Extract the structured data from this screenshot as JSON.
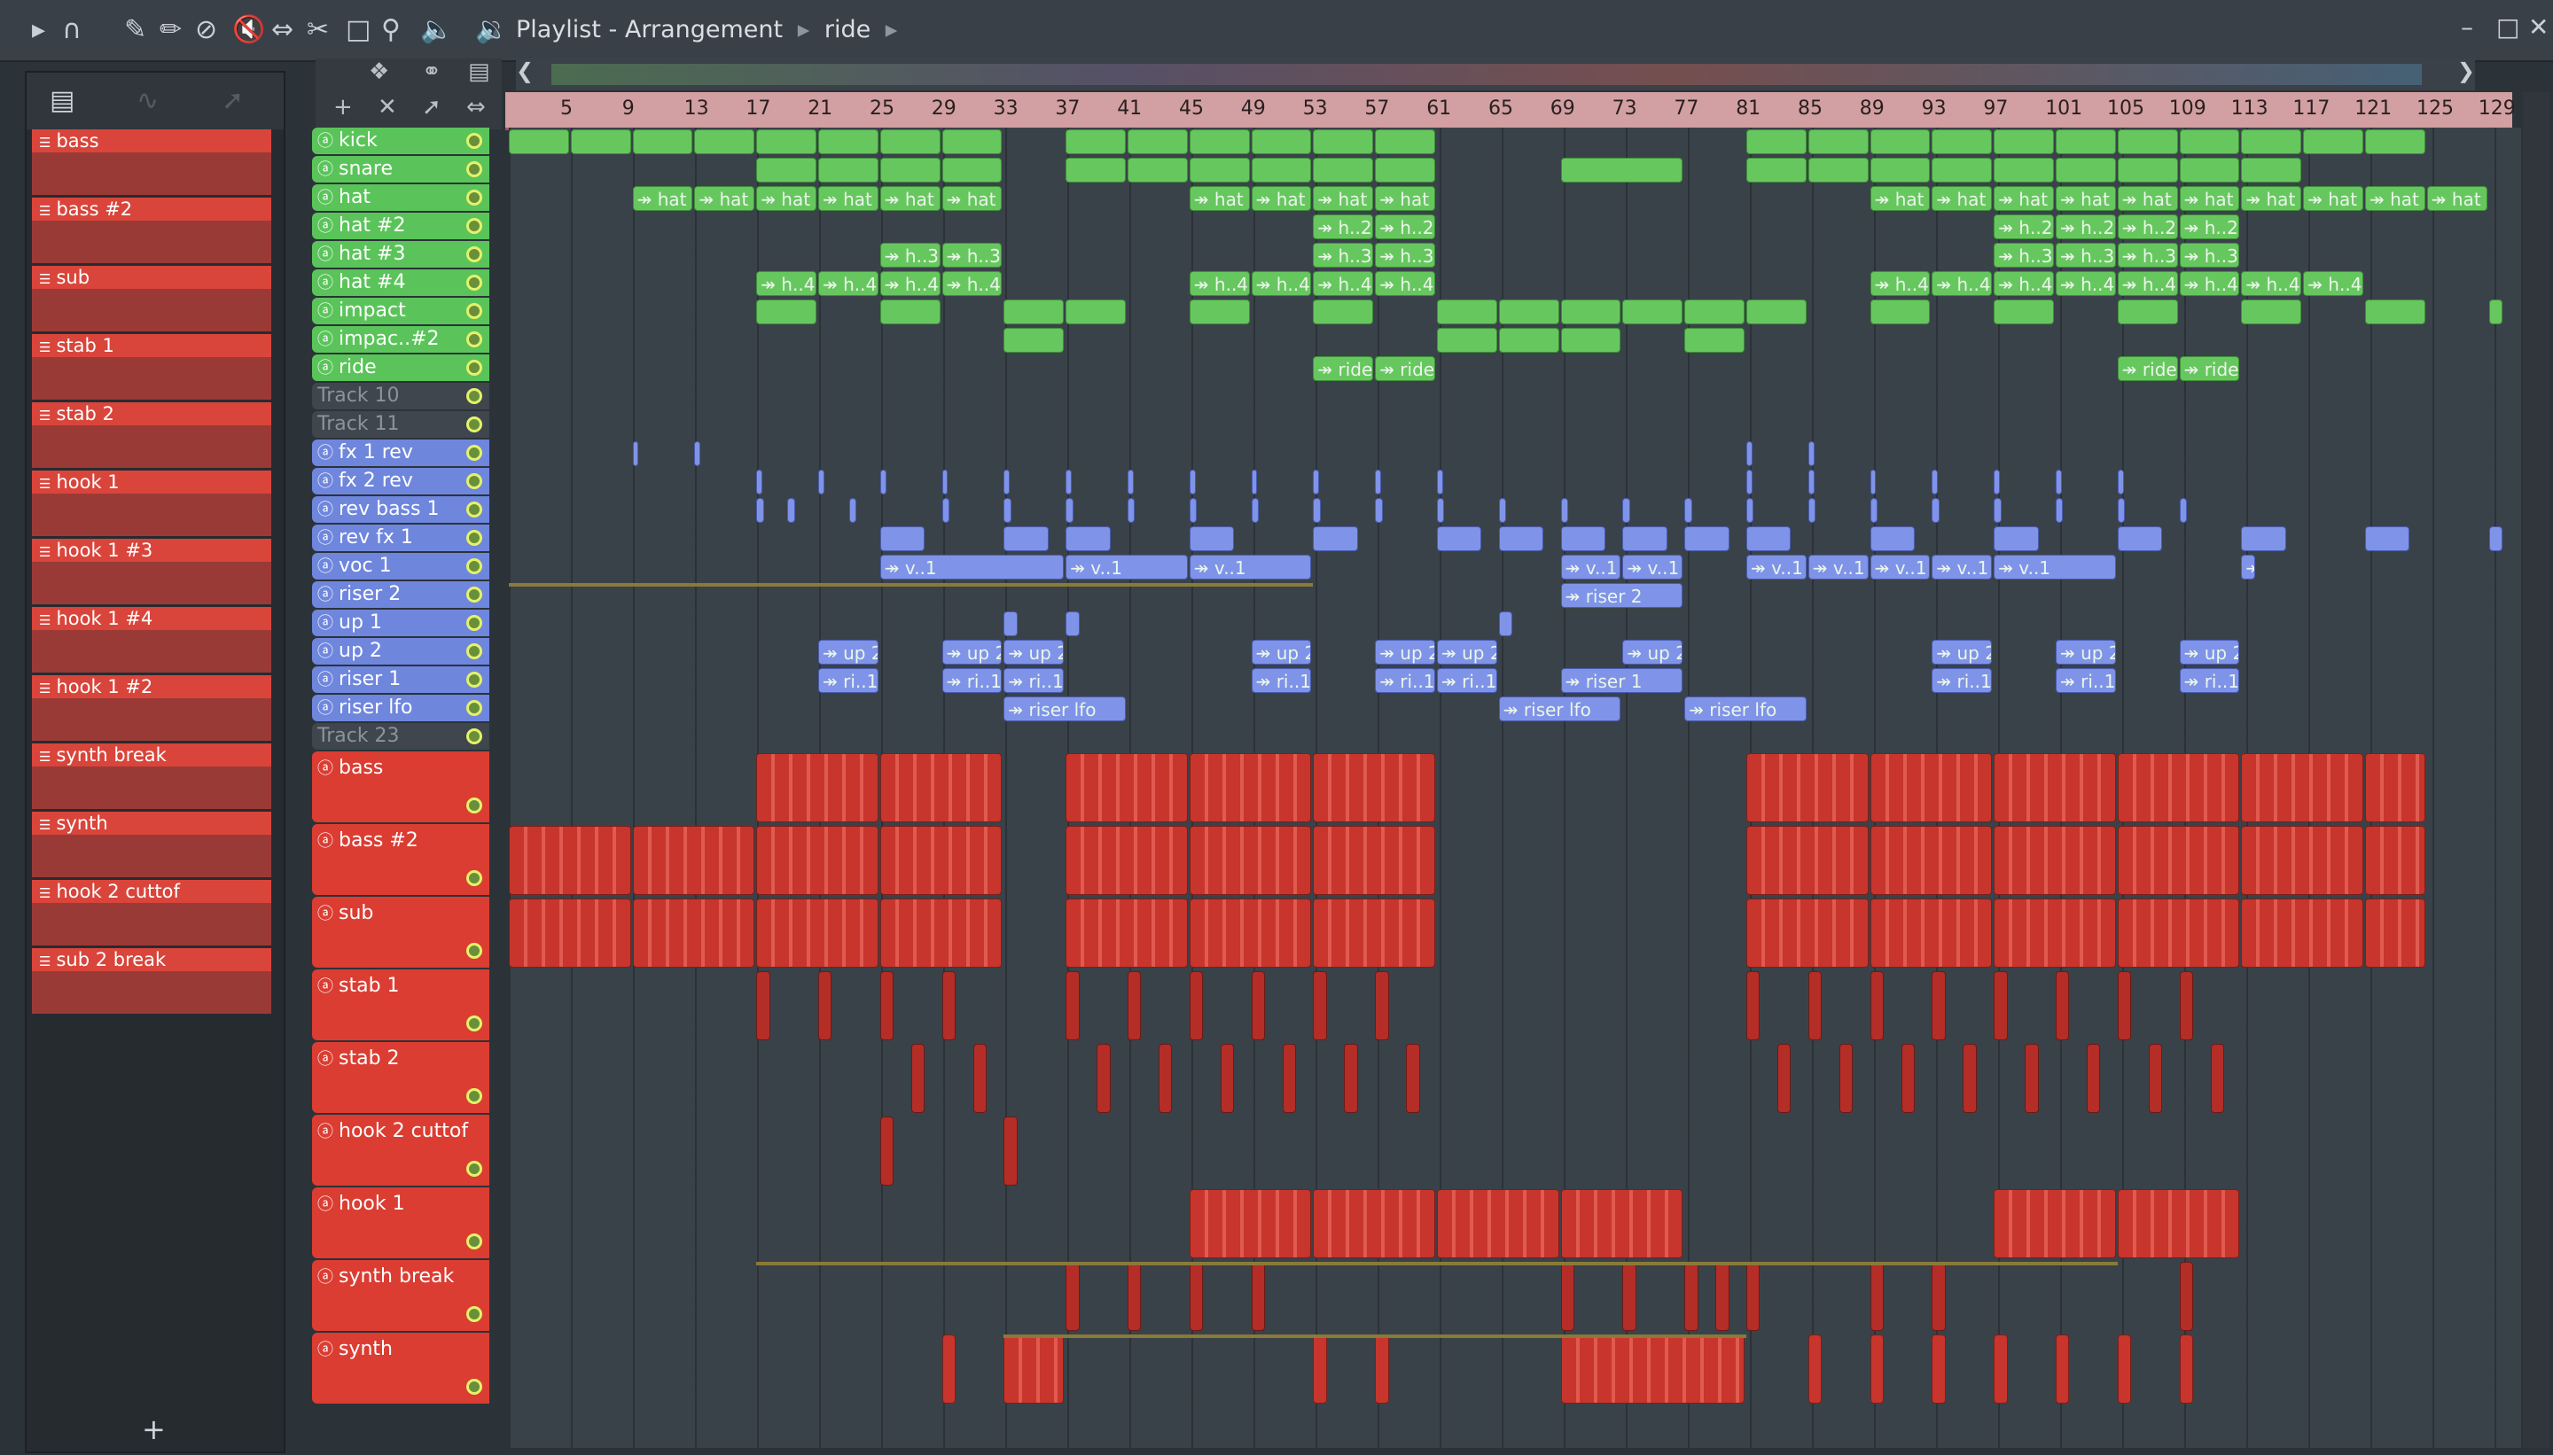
{
  "titlebar": {
    "title": "Playlist - Arrangement",
    "breadcrumb_sep": "▸",
    "pattern": "ride",
    "pattern_arrow": "▸",
    "min": "–",
    "max": "□",
    "close": "✕"
  },
  "picker": {
    "items": [
      "bass",
      "bass #2",
      "sub",
      "stab 1",
      "stab 2",
      "hook 1",
      "hook 1 #3",
      "hook 1 #4",
      "hook 1 #2",
      "synth break",
      "synth",
      "hook 2 cuttof",
      "sub 2 break"
    ],
    "add": "+"
  },
  "ruler": {
    "ticks": [
      "5",
      "9",
      "13",
      "17",
      "21",
      "25",
      "29",
      "33",
      "37",
      "41",
      "45",
      "49",
      "53",
      "57",
      "61",
      "65",
      "69",
      "73",
      "77",
      "81",
      "85",
      "89",
      "93",
      "97",
      "101",
      "105",
      "109",
      "113",
      "117",
      "121",
      "125",
      "129"
    ]
  },
  "tracks": [
    {
      "name": "kick",
      "color": "green"
    },
    {
      "name": "snare",
      "color": "green"
    },
    {
      "name": "hat",
      "color": "green"
    },
    {
      "name": "hat #2",
      "color": "green"
    },
    {
      "name": "hat #3",
      "color": "green"
    },
    {
      "name": "hat #4",
      "color": "green"
    },
    {
      "name": "impact",
      "color": "green"
    },
    {
      "name": "impac..#2",
      "color": "green"
    },
    {
      "name": "ride",
      "color": "green"
    },
    {
      "name": "Track 10",
      "color": "grey"
    },
    {
      "name": "Track 11",
      "color": "grey"
    },
    {
      "name": "fx 1 rev",
      "color": "blue"
    },
    {
      "name": "fx 2 rev",
      "color": "blue"
    },
    {
      "name": "rev bass 1",
      "color": "blue"
    },
    {
      "name": "rev fx 1",
      "color": "blue"
    },
    {
      "name": "voc 1",
      "color": "blue"
    },
    {
      "name": "riser 2",
      "color": "blue"
    },
    {
      "name": "up 1",
      "color": "blue"
    },
    {
      "name": "up 2",
      "color": "blue"
    },
    {
      "name": "riser 1",
      "color": "blue"
    },
    {
      "name": "riser lfo",
      "color": "blue"
    },
    {
      "name": "Track 23",
      "color": "grey"
    },
    {
      "name": "bass",
      "color": "red"
    },
    {
      "name": "bass #2",
      "color": "red"
    },
    {
      "name": "sub",
      "color": "red"
    },
    {
      "name": "stab 1",
      "color": "red"
    },
    {
      "name": "stab 2",
      "color": "red"
    },
    {
      "name": "hook 2 cuttof",
      "color": "red"
    },
    {
      "name": "hook 1",
      "color": "red"
    },
    {
      "name": "synth break",
      "color": "red"
    },
    {
      "name": "synth",
      "color": "red"
    }
  ],
  "clip_labels": {
    "hat": "↠ hat",
    "hat2": "↠ h..2",
    "hat3": "↠ h..3",
    "hat4": "↠ h..4",
    "ride": "↠ ride",
    "voc": "↠ v..1",
    "riser2": "↠ riser 2",
    "up2": "↠ up 2",
    "riser1": "↠ ri..1",
    "riser1full": "↠ riser 1",
    "riserlfo": "↠ riser lfo"
  },
  "colors": {
    "green": "#5ac45a",
    "blue": "#6f86dd",
    "red": "#db3d32",
    "ruler": "#d2a0a2"
  }
}
